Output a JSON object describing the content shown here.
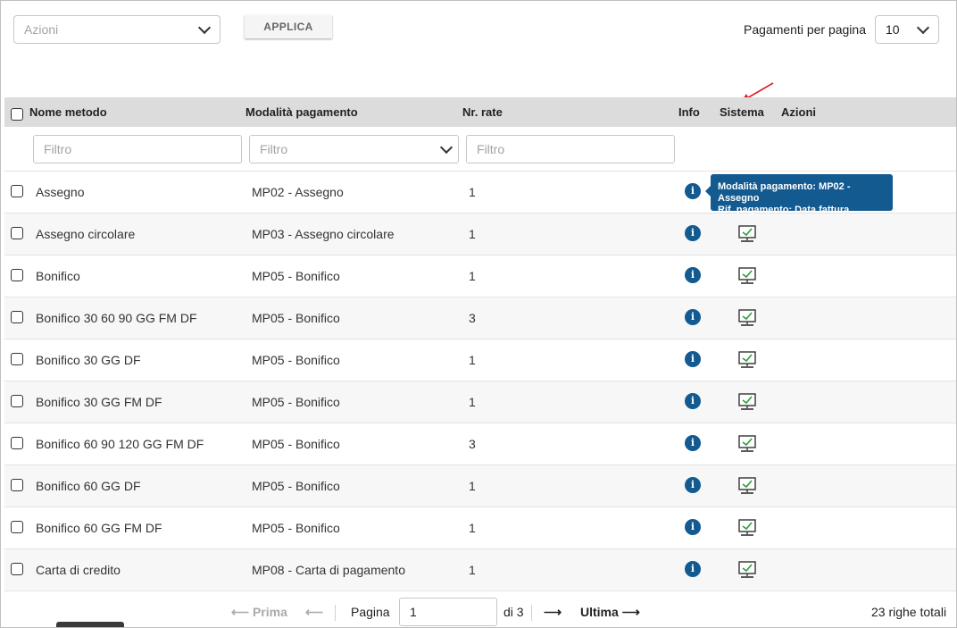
{
  "toolbar": {
    "actions_placeholder": "Azioni",
    "apply_label": "APPLICA",
    "per_page_label": "Pagamenti per pagina",
    "per_page_value": "10"
  },
  "table": {
    "headers": {
      "name": "Nome metodo",
      "mode": "Modalità pagamento",
      "installments": "Nr. rate",
      "info": "Info",
      "system": "Sistema",
      "actions": "Azioni"
    },
    "filters": {
      "name_placeholder": "Filtro",
      "mode_placeholder": "Filtro",
      "installments_placeholder": "Filtro"
    },
    "rows": [
      {
        "name": "Assegno",
        "mode": "MP02 - Assegno",
        "installments": "1",
        "system": false
      },
      {
        "name": "Assegno circolare",
        "mode": "MP03 - Assegno circolare",
        "installments": "1",
        "system": true
      },
      {
        "name": "Bonifico",
        "mode": "MP05 - Bonifico",
        "installments": "1",
        "system": true
      },
      {
        "name": "Bonifico 30 60 90 GG FM DF",
        "mode": "MP05 - Bonifico",
        "installments": "3",
        "system": true
      },
      {
        "name": "Bonifico 30 GG DF",
        "mode": "MP05 - Bonifico",
        "installments": "1",
        "system": true
      },
      {
        "name": "Bonifico 30 GG FM DF",
        "mode": "MP05 - Bonifico",
        "installments": "1",
        "system": true
      },
      {
        "name": "Bonifico 60 90 120 GG FM DF",
        "mode": "MP05 - Bonifico",
        "installments": "3",
        "system": true
      },
      {
        "name": "Bonifico 60 GG DF",
        "mode": "MP05 - Bonifico",
        "installments": "1",
        "system": true
      },
      {
        "name": "Bonifico 60 GG FM DF",
        "mode": "MP05 - Bonifico",
        "installments": "1",
        "system": true
      },
      {
        "name": "Carta di credito",
        "mode": "MP08 - Carta di pagamento",
        "installments": "1",
        "system": true
      }
    ]
  },
  "tooltip": {
    "line1": "Modalità pagamento: MP02 - Assegno",
    "line2": "Rif. pagamento: Data fattura"
  },
  "pagination": {
    "first_label": "Prima",
    "page_label": "Pagina",
    "current_page": "1",
    "of_label": "di 3",
    "last_label": "Ultima",
    "total_label": "23 righe totali"
  },
  "colors": {
    "accent": "#135a91",
    "header_bg": "#dcdcdc",
    "annotation_arrow": "#e02020"
  }
}
